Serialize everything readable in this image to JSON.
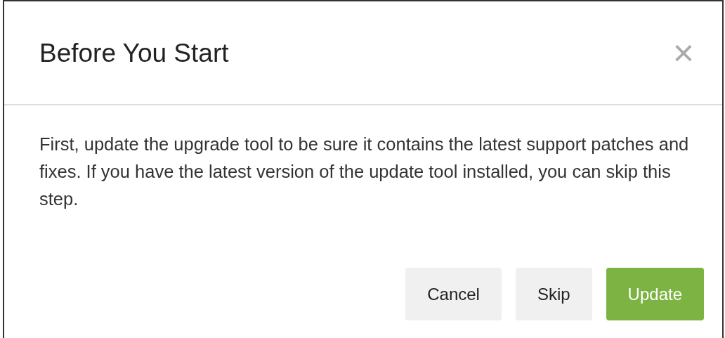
{
  "dialog": {
    "title": "Before You Start",
    "close": "×",
    "message": "First, update the upgrade tool to be sure it contains the latest support patches and fixes. If you have the latest version of the update tool installed, you can skip this step.",
    "buttons": [
      {
        "label": "Cancel",
        "kind": "default"
      },
      {
        "label": "Skip",
        "kind": "default"
      },
      {
        "label": "Update",
        "kind": "primary"
      }
    ]
  }
}
